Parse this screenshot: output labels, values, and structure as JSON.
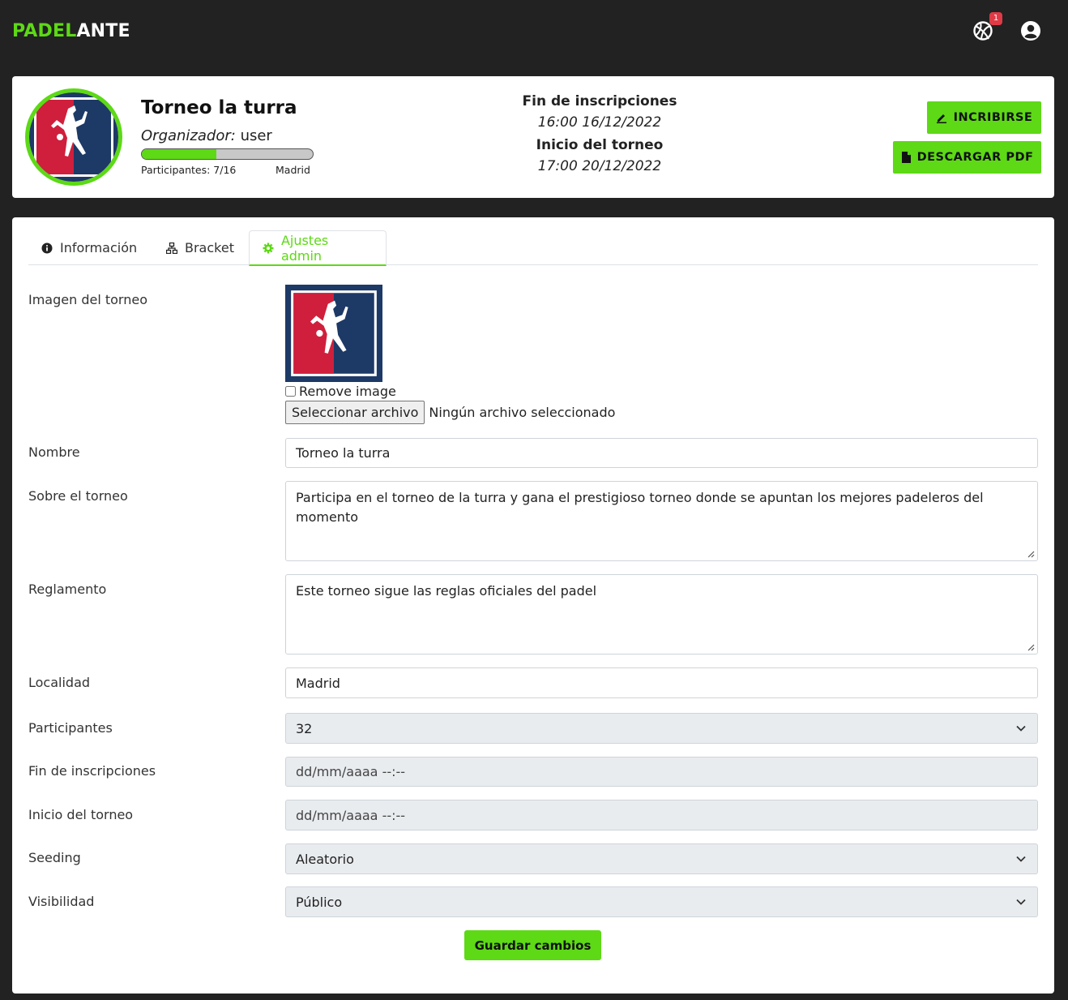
{
  "navbar": {
    "brand_part1": "PADEL",
    "brand_part2": "ANTE",
    "notifications_icon": "basketball-icon",
    "notifications_count": "1",
    "user_icon": "user-circle-icon"
  },
  "tournament": {
    "title": "Torneo la turra",
    "organizer_label": "Organizador:",
    "organizer_value": "user",
    "participants_text": "Participantes: 7/16",
    "participants_fraction": 0.4375,
    "city": "Madrid",
    "registration_end_label": "Fin de inscripciones",
    "registration_end_value": "16:00 16/12/2022",
    "start_label": "Inicio del torneo",
    "start_value": "17:00 20/12/2022",
    "register_button": "INCRIBIRSE",
    "pdf_button": "DESCARGAR PDF"
  },
  "tabs": [
    {
      "label": "Información",
      "icon": "info-icon"
    },
    {
      "label": "Bracket",
      "icon": "sitemap-icon"
    },
    {
      "label": "Ajustes admin",
      "icon": "gear-icon",
      "active": true
    }
  ],
  "form": {
    "image_label": "Imagen del torneo",
    "remove_image_label": "Remove image",
    "file_button": "Seleccionar archivo",
    "file_status": "Ningún archivo seleccionado",
    "name_label": "Nombre",
    "name_value": "Torneo la turra",
    "about_label": "Sobre el torneo",
    "about_value": "Participa en el torneo de la turra y gana el prestigioso torneo donde se apuntan los mejores padeleros del momento",
    "rules_label": "Reglamento",
    "rules_value": "Este torneo sigue las reglas oficiales del padel",
    "location_label": "Localidad",
    "location_value": "Madrid",
    "participants_label": "Participantes",
    "participants_value": "32",
    "reg_end_label": "Fin de inscripciones",
    "reg_end_value": "dd/mm/aaaa --:--",
    "start_label": "Inicio del torneo",
    "start_value": "dd/mm/aaaa --:--",
    "seeding_label": "Seeding",
    "seeding_value": "Aleatorio",
    "visibility_label": "Visibilidad",
    "visibility_value": "Público",
    "save_button": "Guardar cambios"
  },
  "colors": {
    "accent": "#5dd916",
    "navbar_bg": "#222222",
    "badge": "#e03a46",
    "logo_red": "#cf1f3c",
    "logo_blue": "#1d3966"
  }
}
